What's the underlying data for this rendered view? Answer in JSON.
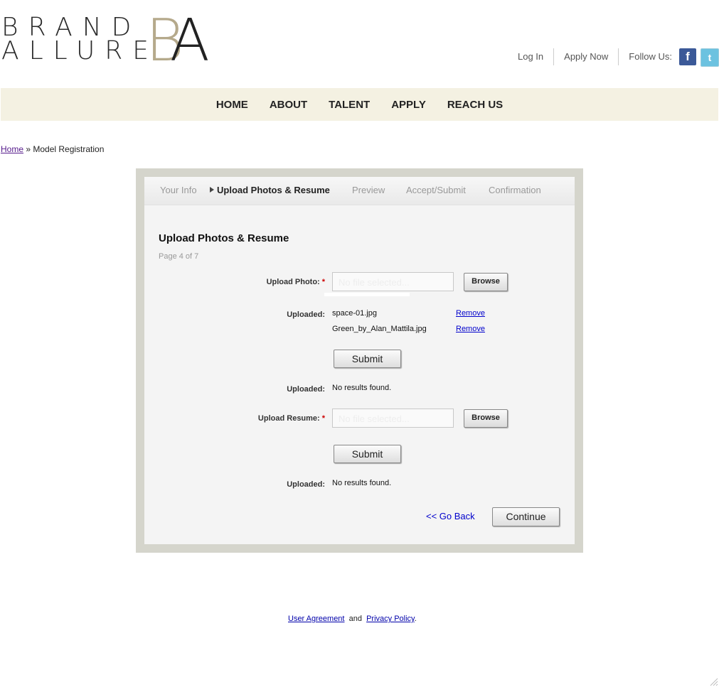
{
  "logo": {
    "word1": "BRAND",
    "word2": "ALLURE",
    "mark_b": "B",
    "mark_a": "A"
  },
  "header": {
    "login": "Log In",
    "apply_now": "Apply Now",
    "follow_us": "Follow Us:",
    "facebook_icon": "f",
    "twitter_icon": "t"
  },
  "nav": {
    "items": [
      "HOME",
      "ABOUT",
      "TALENT",
      "APPLY",
      "REACH US"
    ]
  },
  "breadcrumb": {
    "home": "Home",
    "separator": " » ",
    "current": "Model Registration"
  },
  "steps": [
    {
      "label": "Your Info"
    },
    {
      "label": "Upload Photos & Resume"
    },
    {
      "label": "Preview"
    },
    {
      "label": "Accept/Submit"
    },
    {
      "label": "Confirmation"
    }
  ],
  "form": {
    "title": "Upload Photos & Resume",
    "page_of": "Page 4 of 7",
    "upload_photo_label": "Upload Photo:",
    "upload_resume_label": "Upload Resume:",
    "required_marker": "*",
    "file_placeholder": "No file selected...",
    "browse_label": "Browse",
    "uploaded_label": "Uploaded:",
    "photo_files": [
      {
        "name": "space-01.jpg",
        "action": "Remove"
      },
      {
        "name": "Green_by_Alan_Mattila.jpg",
        "action": "Remove"
      }
    ],
    "submit_label": "Submit",
    "no_results": "No results found.",
    "go_back": "<< Go Back",
    "continue_label": "Continue"
  },
  "footer": {
    "user_agreement": "User Agreement",
    "and": "and",
    "privacy_policy": "Privacy Policy",
    "period": "."
  },
  "colors": {
    "accent_gold": "#b5a98b",
    "nav_bg": "#f4f1e2",
    "frame": "#d5d5cc",
    "link_blue": "#0000cc"
  }
}
